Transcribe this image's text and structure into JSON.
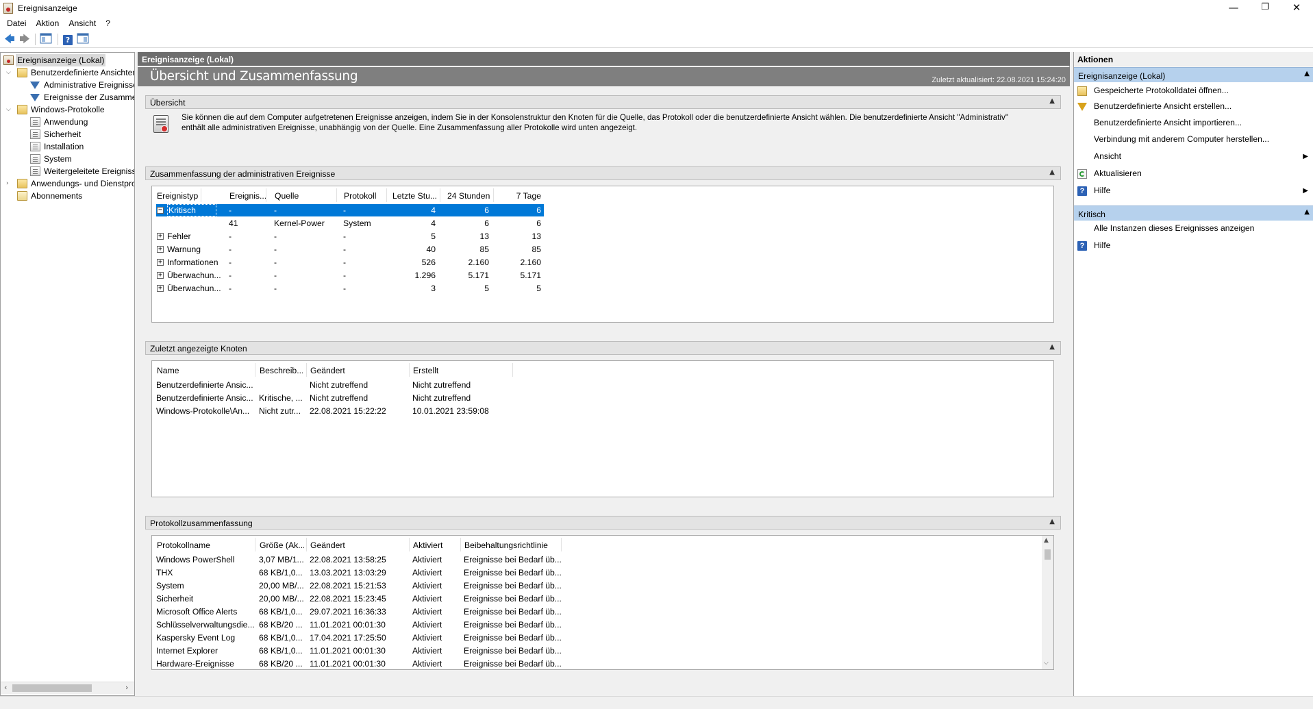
{
  "window": {
    "title": "Ereignisanzeige",
    "minimize": "—",
    "restore": "❐",
    "close": "✕"
  },
  "menu": [
    "Datei",
    "Aktion",
    "Ansicht",
    "?"
  ],
  "toolbar": {
    "back": "🡄",
    "forward": "🡆",
    "help": "?"
  },
  "tree": {
    "root": "Ereignisanzeige (Lokal)",
    "custom_views": "Benutzerdefinierte Ansichten",
    "admin_events": "Administrative Ereignisse",
    "summary_events": "Ereignisse der Zusammenfassung",
    "windows_logs": "Windows-Protokolle",
    "app": "Anwendung",
    "security": "Sicherheit",
    "setup": "Installation",
    "system": "System",
    "forwarded": "Weitergeleitete Ereignisse",
    "app_services": "Anwendungs- und Dienstprotokolle",
    "subscriptions": "Abonnements"
  },
  "main": {
    "header": "Ereignisanzeige (Lokal)",
    "banner_title": "Übersicht und Zusammenfassung",
    "last_updated": "Zuletzt aktualisiert: 22.08.2021 15:24:20",
    "overview": {
      "title": "Übersicht",
      "text1": "Sie können die auf dem Computer aufgetretenen Ereignisse anzeigen, indem Sie in der Konsolenstruktur den Knoten für die Quelle, das Protokoll oder die benutzerdefinierte Ansicht wählen. Die benutzerdefinierte Ansicht \"Administrativ\"",
      "text2": "enthält alle administrativen Ereignisse, unabhängig von der Quelle. Eine Zusammenfassung aller Protokolle wird unten angezeigt."
    },
    "admin_summary": {
      "title": "Zusammenfassung der administrativen Ereignisse",
      "columns": [
        "Ereignistyp",
        "Ereignis...",
        "Quelle",
        "Protokoll",
        "Letzte Stu...",
        "24 Stunden",
        "7 Tage"
      ],
      "rows": [
        [
          "Kritisch",
          "-",
          "-",
          "-",
          "4",
          "6",
          "6"
        ],
        [
          "",
          "41",
          "Kernel-Power",
          "System",
          "4",
          "6",
          "6"
        ],
        [
          "Fehler",
          "-",
          "-",
          "-",
          "5",
          "13",
          "13"
        ],
        [
          "Warnung",
          "-",
          "-",
          "-",
          "40",
          "85",
          "85"
        ],
        [
          "Informationen",
          "-",
          "-",
          "-",
          "526",
          "2.160",
          "2.160"
        ],
        [
          "Überwachun...",
          "-",
          "-",
          "-",
          "1.296",
          "5.171",
          "5.171"
        ],
        [
          "Überwachun...",
          "-",
          "-",
          "-",
          "3",
          "5",
          "5"
        ]
      ]
    },
    "recent_nodes": {
      "title": "Zuletzt angezeigte Knoten",
      "columns": [
        "Name",
        "Beschreib...",
        "Geändert",
        "Erstellt"
      ],
      "rows": [
        [
          "Benutzerdefinierte Ansic...",
          "",
          "Nicht zutreffend",
          "Nicht zutreffend"
        ],
        [
          "Benutzerdefinierte Ansic...",
          "Kritische, ...",
          "Nicht zutreffend",
          "Nicht zutreffend"
        ],
        [
          "Windows-Protokolle\\An...",
          "Nicht zutr...",
          "22.08.2021 15:22:22",
          "10.01.2021 23:59:08"
        ]
      ]
    },
    "log_summary": {
      "title": "Protokollzusammenfassung",
      "columns": [
        "Protokollname",
        "Größe (Ak...",
        "Geändert",
        "Aktiviert",
        "Beibehaltungsrichtlinie"
      ],
      "rows": [
        [
          "Windows PowerShell",
          "3,07 MB/1...",
          "22.08.2021 13:58:25",
          "Aktiviert",
          "Ereignisse bei Bedarf üb..."
        ],
        [
          "THX",
          "68 KB/1,0...",
          "13.03.2021 13:03:29",
          "Aktiviert",
          "Ereignisse bei Bedarf üb..."
        ],
        [
          "System",
          "20,00 MB/...",
          "22.08.2021 15:21:53",
          "Aktiviert",
          "Ereignisse bei Bedarf üb..."
        ],
        [
          "Sicherheit",
          "20,00 MB/...",
          "22.08.2021 15:23:45",
          "Aktiviert",
          "Ereignisse bei Bedarf üb..."
        ],
        [
          "Microsoft Office Alerts",
          "68 KB/1,0...",
          "29.07.2021 16:36:33",
          "Aktiviert",
          "Ereignisse bei Bedarf üb..."
        ],
        [
          "Schlüsselverwaltungsdie...",
          "68 KB/20 ...",
          "11.01.2021 00:01:30",
          "Aktiviert",
          "Ereignisse bei Bedarf üb..."
        ],
        [
          "Kaspersky Event Log",
          "68 KB/1,0...",
          "17.04.2021 17:25:50",
          "Aktiviert",
          "Ereignisse bei Bedarf üb..."
        ],
        [
          "Internet Explorer",
          "68 KB/1,0...",
          "11.01.2021 00:01:30",
          "Aktiviert",
          "Ereignisse bei Bedarf üb..."
        ],
        [
          "Hardware-Ereignisse",
          "68 KB/20 ...",
          "11.01.2021 00:01:30",
          "Aktiviert",
          "Ereignisse bei Bedarf üb..."
        ]
      ]
    }
  },
  "actions": {
    "header": "Aktionen",
    "group1": "Ereignisanzeige (Lokal)",
    "items1": [
      "Gespeicherte Protokolldatei öffnen...",
      "Benutzerdefinierte Ansicht erstellen...",
      "Benutzerdefinierte Ansicht importieren...",
      "Verbindung mit anderem Computer herstellen...",
      "Ansicht",
      "Aktualisieren",
      "Hilfe"
    ],
    "group2": "Kritisch",
    "items2": [
      "Alle Instanzen dieses Ereignisses anzeigen",
      "Hilfe"
    ]
  },
  "colors": {
    "selection": "#0078d7",
    "banner": "#7f7f7f",
    "header": "#6e6e6e",
    "action_group": "#b6d1ed"
  }
}
